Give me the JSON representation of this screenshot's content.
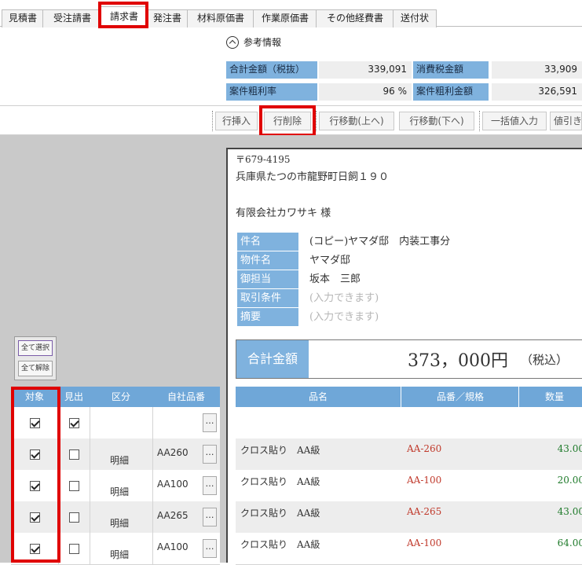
{
  "tabs": [
    "見積書",
    "受注請書",
    "請求書",
    "発注書",
    "材料原価書",
    "作業原価書",
    "その他経費書",
    "送付状"
  ],
  "active_tab": "請求書",
  "reference": {
    "title": "参考情報",
    "rows": [
      {
        "label1": "合計金額（税抜）",
        "value1": "339,091",
        "label2": "消費税金額",
        "value2": "33,909"
      },
      {
        "label1": "案件粗利率",
        "value1": "96 %",
        "label2": "案件粗利金額",
        "value2": "326,591"
      }
    ]
  },
  "toolbar": {
    "insert_row": "行挿入",
    "delete_row": "行削除",
    "move_up": "行移動(上へ)",
    "move_down": "行移動(下へ)",
    "bulk_input": "一括値入力",
    "discount": "値引き"
  },
  "selection": {
    "select_all": "全て選択",
    "deselect_all": "全て解除"
  },
  "grid": {
    "headers": [
      "対象",
      "見出",
      "区分",
      "自社品番"
    ],
    "rows": [
      {
        "target": true,
        "heading": true,
        "category": "",
        "code": ""
      },
      {
        "target": true,
        "heading": false,
        "category": "明細",
        "code": "AA260"
      },
      {
        "target": true,
        "heading": false,
        "category": "明細",
        "code": "AA100"
      },
      {
        "target": true,
        "heading": false,
        "category": "明細",
        "code": "AA265"
      },
      {
        "target": true,
        "heading": false,
        "category": "明細",
        "code": "AA100"
      }
    ],
    "ellipsis": "…"
  },
  "document": {
    "postal": "〒679-4195",
    "address": "兵庫県たつの市龍野町日飼１９０",
    "recipient": "有限会社カワサキ 様",
    "fields": [
      {
        "label": "件名",
        "value": "(コピー)ヤマダ邸　内装工事分",
        "placeholder": false
      },
      {
        "label": "物件名",
        "value": "ヤマダ邸",
        "placeholder": false
      },
      {
        "label": "御担当",
        "value": "坂本　三郎",
        "placeholder": false
      },
      {
        "label": "取引条件",
        "value": "(入力できます)",
        "placeholder": true
      },
      {
        "label": "摘要",
        "value": "(入力できます)",
        "placeholder": true
      }
    ],
    "total": {
      "label": "合計金額",
      "amount": "373，000円",
      "tax_note": "（税込）"
    },
    "table_headers": [
      "品名",
      "品番／規格",
      "数量"
    ],
    "items": [
      {
        "name": "",
        "spec": "",
        "qty": ""
      },
      {
        "name": "クロス貼り　AA級",
        "spec": "AA-260",
        "qty": "43.00"
      },
      {
        "name": "クロス貼り　AA級",
        "spec": "AA-100",
        "qty": "20.00"
      },
      {
        "name": "クロス貼り　AA級",
        "spec": "AA-265",
        "qty": "43.00"
      },
      {
        "name": "クロス貼り　AA級",
        "spec": "AA-100",
        "qty": "64.00"
      }
    ]
  },
  "colors": {
    "header_blue": "#6fa7d8",
    "label_blue": "#7fb2de",
    "highlight_red": "#e00000",
    "spec_red": "#c0392b",
    "qty_green": "#1e7a2a"
  }
}
